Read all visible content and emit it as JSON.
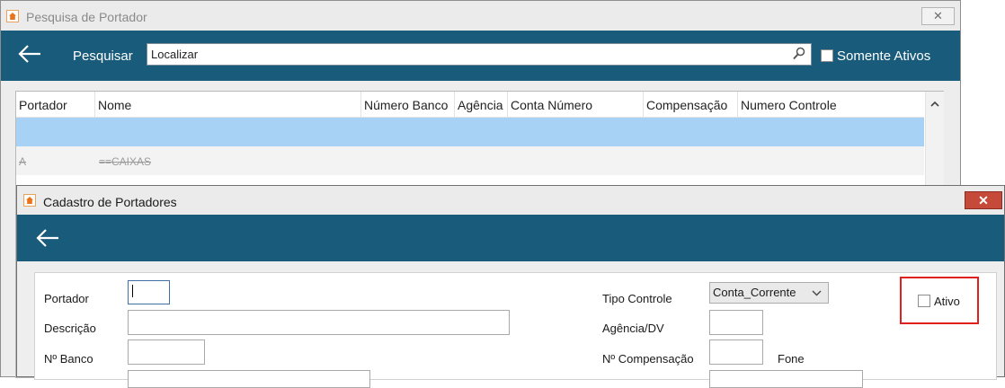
{
  "pesquisa": {
    "title": "Pesquisa de Portador",
    "close_glyph": "✕",
    "search_label": "Pesquisar",
    "search_value": "Localizar",
    "somente_ativos_label": "Somente Ativos",
    "somente_ativos_checked": false,
    "columns": [
      "Portador",
      "Nome",
      "Número Banco",
      "Agência",
      "Conta Número",
      "Compensação",
      "Numero Controle"
    ],
    "rows": [
      {
        "portador": "",
        "nome": ""
      },
      {
        "portador": "A",
        "nome": "==CAIXAS"
      }
    ]
  },
  "cadastro": {
    "title": "Cadastro de Portadores",
    "close_glyph": "✕",
    "labels": {
      "portador": "Portador",
      "descricao": "Descrição",
      "nbanco": "Nº Banco",
      "tipo_controle": "Tipo Controle",
      "agencia_dv": "Agência/DV",
      "compensacao": "Nº Compensação",
      "fone": "Fone",
      "ativo": "Ativo"
    },
    "values": {
      "portador": "",
      "descricao": "",
      "nbanco": "",
      "tipo_controle": "Conta_Corrente",
      "agencia": "",
      "compensacao": ""
    },
    "ativo_checked": false
  },
  "colors": {
    "toolbar": "#195b7b",
    "selected_row": "#a8d1f6",
    "highlight": "#e0201c"
  }
}
